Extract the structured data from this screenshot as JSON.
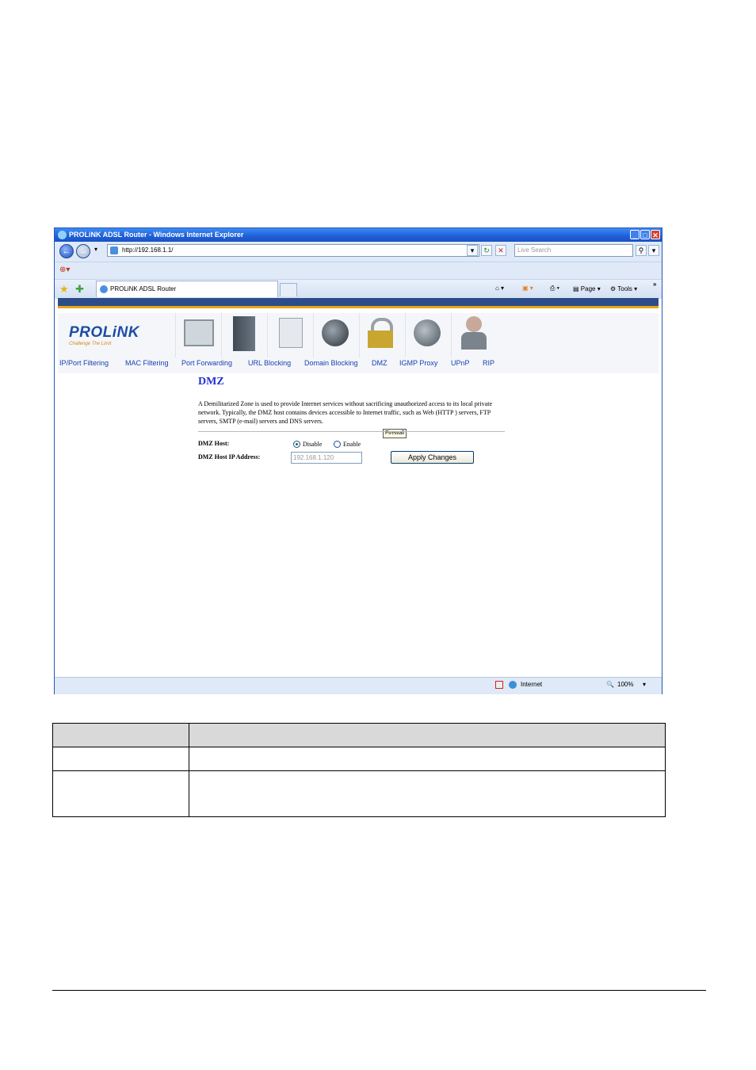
{
  "window": {
    "title": "PROLiNK ADSL Router - Windows Internet Explorer",
    "address": "http://192.168.1.1/",
    "search_placeholder": "Live Search",
    "tab_label": "PROLiNK ADSL Router",
    "toolbar_page": "Page",
    "toolbar_tools": "Tools",
    "more_chevron": "»",
    "status_zone": "Internet",
    "zoom": "100%"
  },
  "router": {
    "logo": "PROLiNK",
    "tagline": "Challenge The Limit",
    "tooltip": "Firewall",
    "menu": [
      "IP/Port Filtering",
      "MAC Filtering",
      "Port Forwarding",
      "URL Blocking",
      "Domain Blocking",
      "DMZ",
      "IGMP Proxy",
      "UPnP",
      "RIP"
    ],
    "page_title": "DMZ",
    "description": "A Demilitarized Zone is used to provide Internet services without sacrificing unauthorized access to its local private network. Typically, the DMZ host contains devices accessible to Internet traffic, such as Web (HTTP ) servers, FTP servers, SMTP (e-mail) servers and DNS servers.",
    "dmz_host_label": "DMZ Host:",
    "disable_label": "Disable",
    "enable_label": "Enable",
    "ip_label": "DMZ Host IP Address:",
    "ip_value": "192.168.1.120",
    "apply_label": "Apply Changes"
  },
  "colors": {
    "title_blue": "#1f2fd4",
    "menu_blue": "#1a3fb0",
    "accent_yellow": "#e6a51a"
  }
}
